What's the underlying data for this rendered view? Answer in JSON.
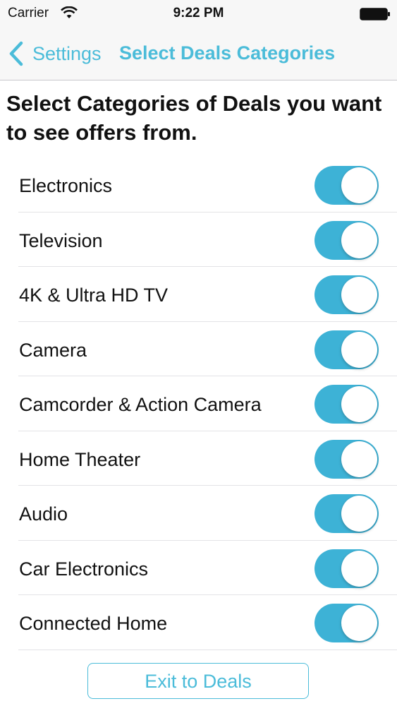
{
  "status_bar": {
    "carrier": "Carrier",
    "time": "9:22 PM",
    "icons": [
      "wifi-icon",
      "battery-icon"
    ]
  },
  "nav": {
    "back_label": "Settings",
    "title": "Select Deals Categories",
    "back_icon": "chevron-left-icon"
  },
  "heading": "Select Categories of Deals you want to see offers from.",
  "categories": [
    {
      "label": "Electronics",
      "enabled": true
    },
    {
      "label": "Television",
      "enabled": true
    },
    {
      "label": "4K & Ultra HD TV",
      "enabled": true
    },
    {
      "label": "Camera",
      "enabled": true
    },
    {
      "label": "Camcorder & Action Camera",
      "enabled": true
    },
    {
      "label": "Home Theater",
      "enabled": true
    },
    {
      "label": "Audio",
      "enabled": true
    },
    {
      "label": "Car Electronics",
      "enabled": true
    },
    {
      "label": "Connected Home",
      "enabled": true
    }
  ],
  "exit_button_label": "Exit to Deals",
  "colors": {
    "accent": "#4bbcd9",
    "toggle_on": "#3db2d6",
    "nav_background": "#f7f7f7",
    "separator": "#e3e3e6"
  }
}
